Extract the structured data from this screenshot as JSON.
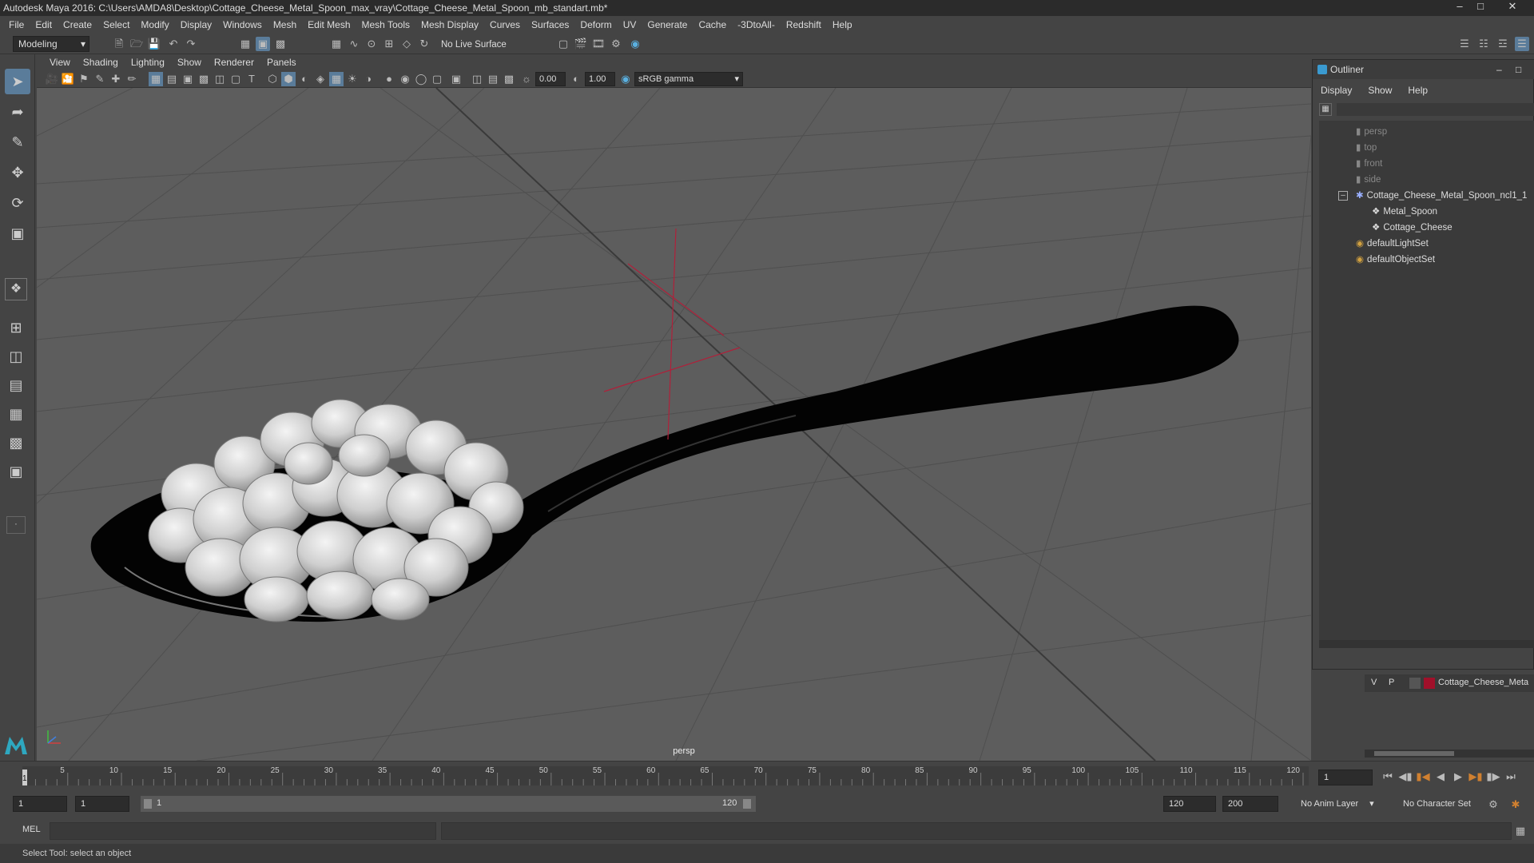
{
  "window": {
    "title": "Autodesk Maya 2016: C:\\Users\\AMDA8\\Desktop\\Cottage_Cheese_Metal_Spoon_max_vray\\Cottage_Cheese_Metal_Spoon_mb_standart.mb*"
  },
  "menu": [
    "File",
    "Edit",
    "Create",
    "Select",
    "Modify",
    "Display",
    "Windows",
    "Mesh",
    "Edit Mesh",
    "Mesh Tools",
    "Mesh Display",
    "Curves",
    "Surfaces",
    "Deform",
    "UV",
    "Generate",
    "Cache",
    "-3DtoAll-",
    "Redshift",
    "Help"
  ],
  "statusline": {
    "mode": "Modeling",
    "live_surface": "No Live Surface"
  },
  "panel": {
    "menu": [
      "View",
      "Shading",
      "Lighting",
      "Show",
      "Renderer",
      "Panels"
    ],
    "exposure": "0.00",
    "gamma": "1.00",
    "colorspace": "sRGB gamma",
    "camera_label": "persp"
  },
  "outliner": {
    "title": "Outliner",
    "menu": [
      "Display",
      "Show",
      "Help"
    ],
    "items": [
      {
        "label": "persp",
        "dim": true
      },
      {
        "label": "top",
        "dim": true
      },
      {
        "label": "front",
        "dim": true
      },
      {
        "label": "side",
        "dim": true
      },
      {
        "label": "Cottage_Cheese_Metal_Spoon_ncl1_1",
        "dim": false
      },
      {
        "label": "Metal_Spoon",
        "dim": false
      },
      {
        "label": "Cottage_Cheese",
        "dim": false
      },
      {
        "label": "defaultLightSet",
        "dim": false
      },
      {
        "label": "defaultObjectSet",
        "dim": false
      }
    ]
  },
  "layer": {
    "v": "V",
    "p": "P",
    "name": "Cottage_Cheese_Meta",
    "color": "#a0102a"
  },
  "timeline": {
    "ticks": [
      "5",
      "10",
      "15",
      "20",
      "25",
      "30",
      "35",
      "40",
      "45",
      "50",
      "55",
      "60",
      "65",
      "70",
      "75",
      "80",
      "85",
      "90",
      "95",
      "100",
      "105",
      "110",
      "115",
      "120"
    ],
    "current_frame": "1",
    "start_label": "1"
  },
  "range": {
    "start": "1",
    "start2": "1",
    "slider_start": "1",
    "slider_end": "120",
    "end": "120",
    "max": "200",
    "anim_layer": "No Anim Layer",
    "char_set": "No Character Set"
  },
  "cmd": {
    "label": "MEL"
  },
  "help": {
    "text": "Select Tool: select an object"
  },
  "colors": {
    "accent": "#5a7c9a",
    "viewport_bg": "#5d5d5d",
    "manipulator": "#b0203a"
  }
}
